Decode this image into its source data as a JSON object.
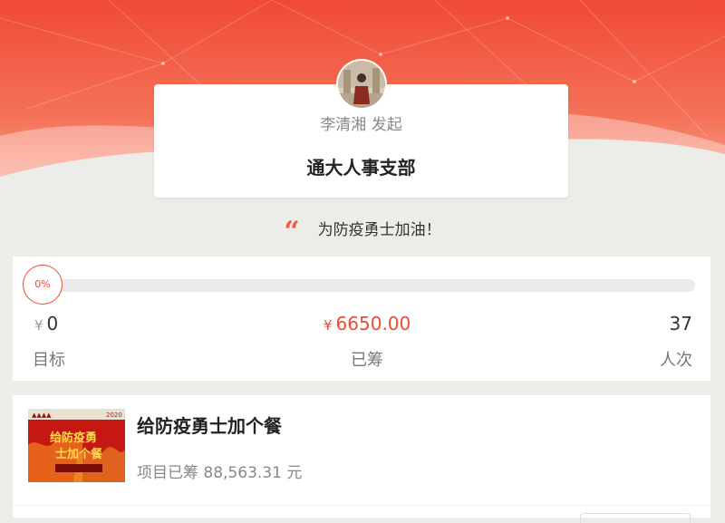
{
  "colors": {
    "brand": "#ef4a33",
    "hero_top": "#f04a35",
    "hero_bottom": "#fbbfad",
    "page_bg": "#ecece9"
  },
  "header": {
    "starter": "李清湘 发起",
    "organization": "通大人事支部",
    "slogan": "为防疫勇士加油！",
    "quote_icon": "quote-icon"
  },
  "progress": {
    "percent_label": "0%",
    "percent_value": 0,
    "target_value": "0",
    "target_label": "目标",
    "raised_value": "6650.00",
    "raised_label": "已筹",
    "count_value": "37",
    "count_label": "人次",
    "currency": "¥"
  },
  "project": {
    "title": "给防疫勇士加个餐",
    "raised_text": "项目已筹 88,563.31 元",
    "thumb_texts": [
      "给防疫勇",
      "士加个餐"
    ],
    "thumb_year": "2020"
  }
}
